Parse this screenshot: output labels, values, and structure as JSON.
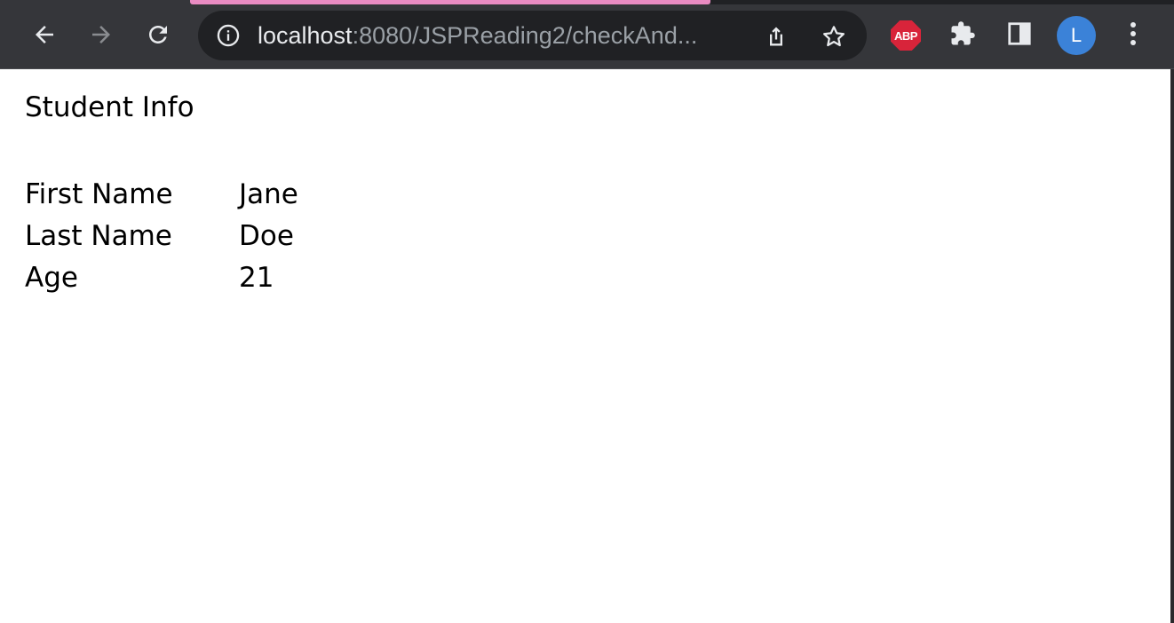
{
  "browser": {
    "url_host": "localhost",
    "url_path": ":8080/JSPReading2/checkAnd...",
    "avatar_letter": "L",
    "extension_abp_label": "ABP",
    "icons": {
      "back": "back-arrow-icon",
      "forward": "forward-arrow-icon",
      "reload": "reload-icon",
      "site_info": "info-icon",
      "share": "share-icon",
      "bookmark": "star-icon",
      "extensions": "puzzle-icon",
      "side_panel": "side-panel-icon",
      "menu": "kebab-menu-icon"
    },
    "colors": {
      "toolbar": "#35363a",
      "omnibox": "#202124",
      "active_tab_accent": "#e98bc2",
      "avatar": "#3b82d8",
      "abp": "#d8243a"
    }
  },
  "page": {
    "title": "Student Info",
    "rows": [
      {
        "label": "First Name",
        "value": "Jane"
      },
      {
        "label": "Last Name",
        "value": "Doe"
      },
      {
        "label": "Age",
        "value": "21"
      }
    ]
  }
}
